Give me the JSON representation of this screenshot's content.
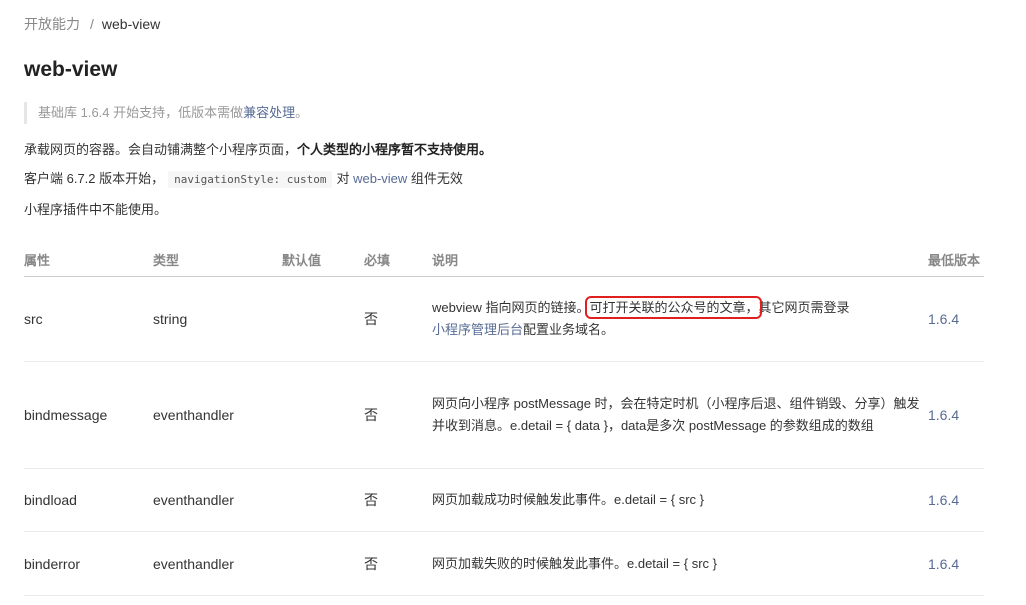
{
  "breadcrumb": {
    "parent": "开放能力",
    "separator": "/",
    "current": "web-view"
  },
  "page_title": "web-view",
  "note": {
    "prefix": "基础库 1.6.4 开始支持，低版本需做",
    "link": "兼容处理",
    "suffix": "。"
  },
  "para1": {
    "text": "承载网页的容器。会自动铺满整个小程序页面，",
    "bold": "个人类型的小程序暂不支持使用。"
  },
  "para2": {
    "prefix": "客户端 6.7.2 版本开始，",
    "code": "navigationStyle: custom",
    "middle": "对",
    "link": "web-view",
    "suffix": "组件无效"
  },
  "para3": {
    "text": "小程序插件中不能使用。"
  },
  "table": {
    "headers": {
      "attr": "属性",
      "type": "类型",
      "default": "默认值",
      "required": "必填",
      "desc": "说明",
      "version": "最低版本"
    },
    "rows": [
      {
        "attr": "src",
        "type": "string",
        "default": "",
        "required": "否",
        "desc_pre": "webview 指向网页的链接。",
        "desc_highlight": "可打开关联的公众号的文章，",
        "desc_post": "其它网页需登录",
        "desc_link": "小程序管理后台",
        "desc_tail": "配置业务域名。",
        "version": "1.6.4"
      },
      {
        "attr": "bindmessage",
        "type": "eventhandler",
        "default": "",
        "required": "否",
        "desc": "网页向小程序 postMessage 时，会在特定时机（小程序后退、组件销毁、分享）触发并收到消息。e.detail = { data }，data是多次 postMessage 的参数组成的数组",
        "version": "1.6.4"
      },
      {
        "attr": "bindload",
        "type": "eventhandler",
        "default": "",
        "required": "否",
        "desc": "网页加载成功时候触发此事件。e.detail = { src }",
        "version": "1.6.4"
      },
      {
        "attr": "binderror",
        "type": "eventhandler",
        "default": "",
        "required": "否",
        "desc": "网页加载失败的时候触发此事件。e.detail = { src }",
        "version": "1.6.4"
      }
    ]
  },
  "colors": {
    "link": "#576b95",
    "highlight_border": "#e02020",
    "muted": "#888888"
  }
}
